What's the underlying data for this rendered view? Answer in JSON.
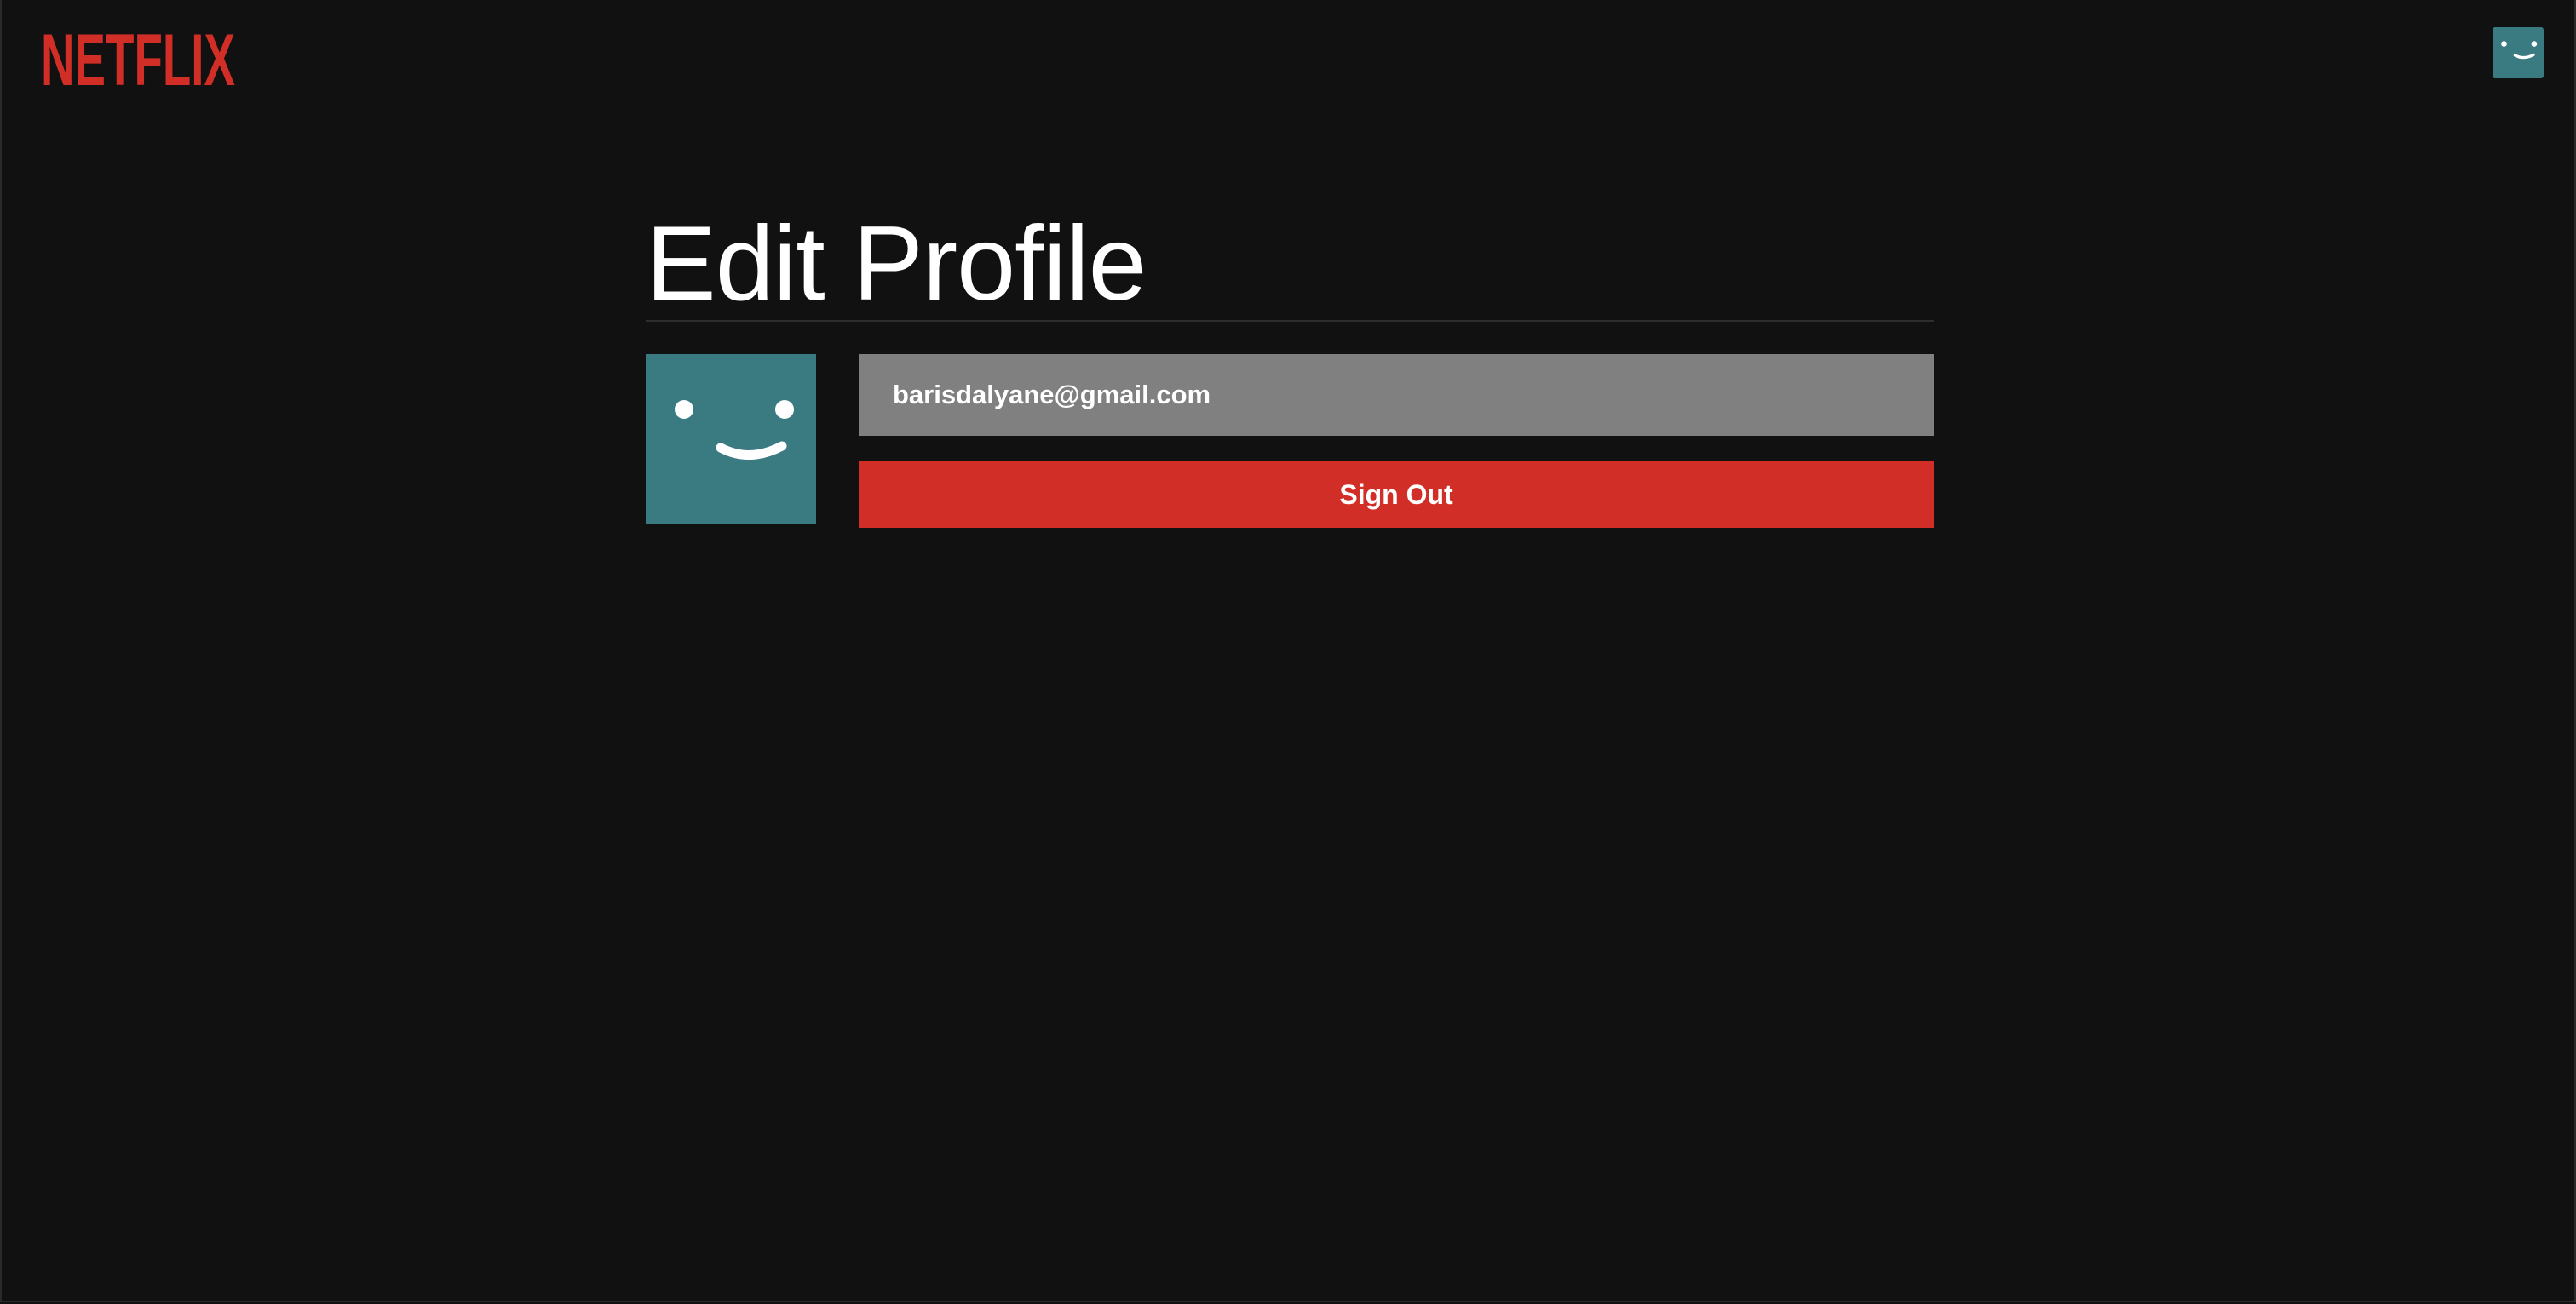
{
  "header": {
    "logo_text": "NETFLIX",
    "logo_icon": "netflix-wordmark",
    "avatar_icon": "smiley-face-icon"
  },
  "main": {
    "title": "Edit Profile",
    "avatar_icon": "smiley-face-icon",
    "email": "barisdalyane@gmail.com",
    "sign_out_label": "Sign Out"
  },
  "colors": {
    "background": "#111111",
    "brand_red": "#d12e27",
    "avatar_teal": "#3a7b82",
    "email_field_bg": "#808080",
    "text": "#ffffff"
  }
}
